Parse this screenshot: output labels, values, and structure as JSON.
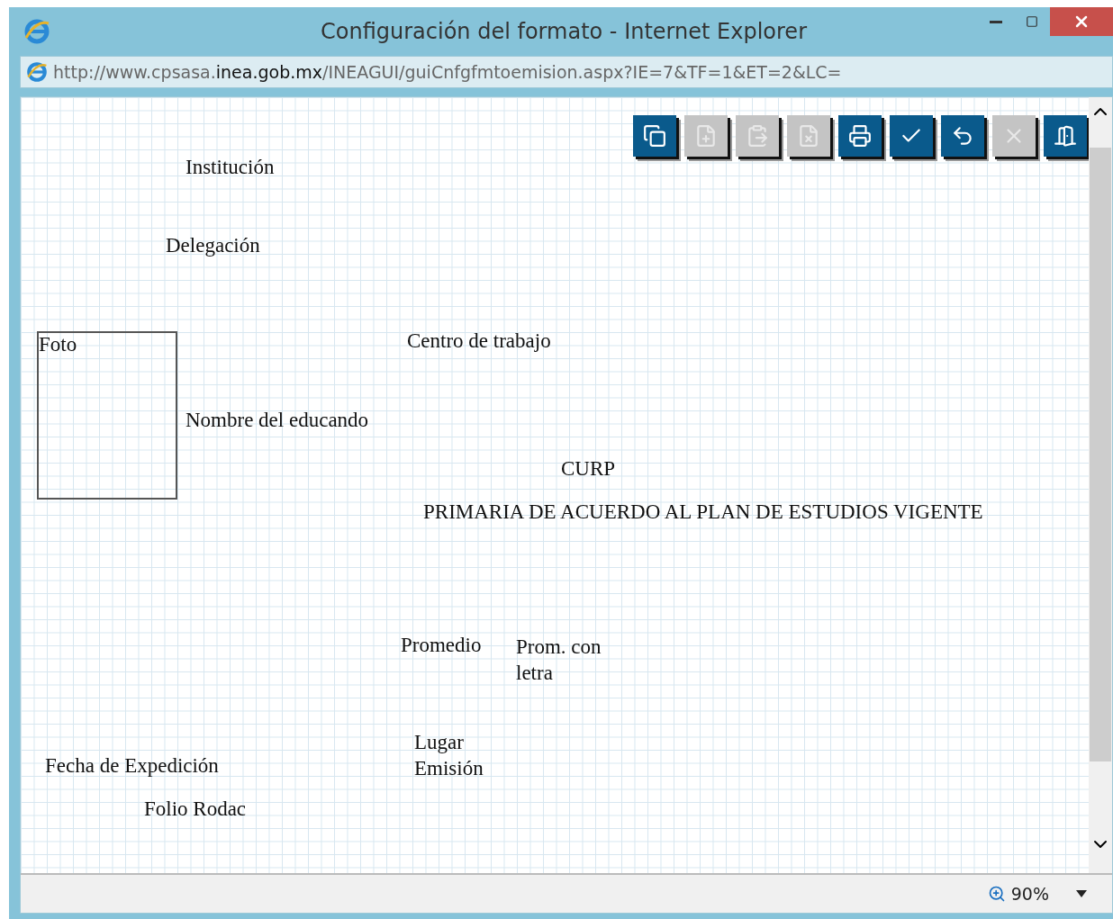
{
  "window": {
    "title": "Configuración del formato - Internet Explorer",
    "address": "http://www.cpsasa.**inea.gob.mx**/INEAGUI/guiCnfgfmtoemision.aspx?IE=7&TF=1&ET=2&LC="
  },
  "toolbar": [
    {
      "kind": "copy",
      "disabled": false
    },
    {
      "kind": "new",
      "disabled": true
    },
    {
      "kind": "paste",
      "disabled": true
    },
    {
      "kind": "delete",
      "disabled": true
    },
    {
      "kind": "print",
      "disabled": false
    },
    {
      "kind": "accept",
      "disabled": false
    },
    {
      "kind": "undo",
      "disabled": false
    },
    {
      "kind": "cancel",
      "disabled": true
    },
    {
      "kind": "exit",
      "disabled": false
    }
  ],
  "canvas_fields": [
    {
      "kind": "text",
      "label": "Institución"
    },
    {
      "kind": "text",
      "label": "Delegación"
    },
    {
      "kind": "photo",
      "label": "Foto"
    },
    {
      "kind": "text",
      "label": "Centro de trabajo"
    },
    {
      "kind": "text",
      "label": "Nombre del educando"
    },
    {
      "kind": "text",
      "label": "CURP"
    },
    {
      "kind": "text",
      "label": "PRIMARIA DE ACUERDO AL PLAN DE ESTUDIOS VIGENTE"
    },
    {
      "kind": "text",
      "label": "Promedio"
    },
    {
      "kind": "text",
      "label": "Prom. con letra"
    },
    {
      "kind": "text",
      "label": "Fecha de Expedición"
    },
    {
      "kind": "text",
      "label": "Lugar Emisión"
    },
    {
      "kind": "text",
      "label": "Folio Rodac"
    }
  ],
  "status_bar": {
    "zoom": "90%"
  }
}
